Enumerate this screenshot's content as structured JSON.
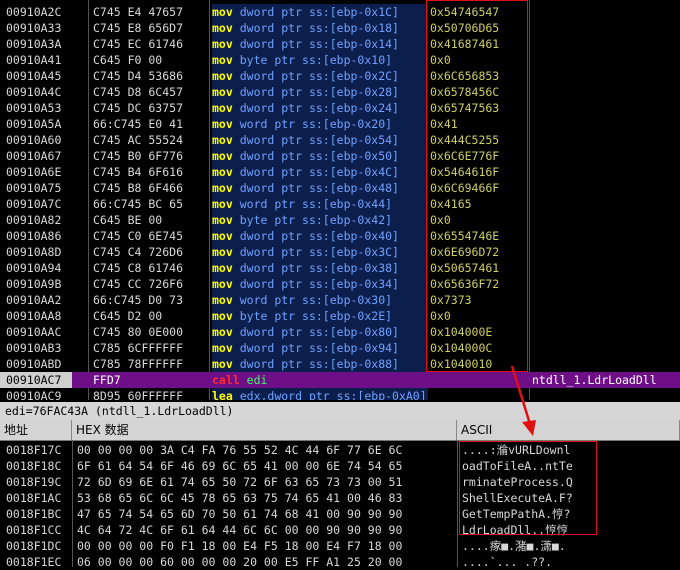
{
  "disasm": {
    "rows": [
      {
        "addr": "00910A2C",
        "hex": "C745 E4 47657",
        "mn": "mov",
        "ops": "dword ptr ss:[ebp-0x1C]",
        "val": "0x54746547",
        "comment": ""
      },
      {
        "addr": "00910A33",
        "hex": "C745 E8 656D7",
        "mn": "mov",
        "ops": "dword ptr ss:[ebp-0x18]",
        "val": "0x50706D65",
        "comment": ""
      },
      {
        "addr": "00910A3A",
        "hex": "C745 EC 61746",
        "mn": "mov",
        "ops": "dword ptr ss:[ebp-0x14]",
        "val": "0x41687461",
        "comment": ""
      },
      {
        "addr": "00910A41",
        "hex": "C645 F0 00",
        "mn": "mov",
        "ops": "byte ptr ss:[ebp-0x10]",
        "val": "0x0",
        "comment": ""
      },
      {
        "addr": "00910A45",
        "hex": "C745 D4 53686",
        "mn": "mov",
        "ops": "dword ptr ss:[ebp-0x2C]",
        "val": "0x6C656853",
        "comment": ""
      },
      {
        "addr": "00910A4C",
        "hex": "C745 D8 6C457",
        "mn": "mov",
        "ops": "dword ptr ss:[ebp-0x28]",
        "val": "0x6578456C",
        "comment": ""
      },
      {
        "addr": "00910A53",
        "hex": "C745 DC 63757",
        "mn": "mov",
        "ops": "dword ptr ss:[ebp-0x24]",
        "val": "0x65747563",
        "comment": ""
      },
      {
        "addr": "00910A5A",
        "hex": "66:C745 E0 41",
        "mn": "mov",
        "ops": "word ptr ss:[ebp-0x20]",
        "val": "0x41",
        "comment": ""
      },
      {
        "addr": "00910A60",
        "hex": "C745 AC 55524",
        "mn": "mov",
        "ops": "dword ptr ss:[ebp-0x54]",
        "val": "0x444C5255",
        "comment": ""
      },
      {
        "addr": "00910A67",
        "hex": "C745 B0 6F776",
        "mn": "mov",
        "ops": "dword ptr ss:[ebp-0x50]",
        "val": "0x6C6E776F",
        "comment": ""
      },
      {
        "addr": "00910A6E",
        "hex": "C745 B4 6F616",
        "mn": "mov",
        "ops": "dword ptr ss:[ebp-0x4C]",
        "val": "0x5464616F",
        "comment": ""
      },
      {
        "addr": "00910A75",
        "hex": "C745 B8 6F466",
        "mn": "mov",
        "ops": "dword ptr ss:[ebp-0x48]",
        "val": "0x6C69466F",
        "comment": ""
      },
      {
        "addr": "00910A7C",
        "hex": "66:C745 BC 65",
        "mn": "mov",
        "ops": "word ptr ss:[ebp-0x44]",
        "val": "0x4165",
        "comment": ""
      },
      {
        "addr": "00910A82",
        "hex": "C645 BE 00",
        "mn": "mov",
        "ops": "byte ptr ss:[ebp-0x42]",
        "val": "0x0",
        "comment": ""
      },
      {
        "addr": "00910A86",
        "hex": "C745 C0 6E745",
        "mn": "mov",
        "ops": "dword ptr ss:[ebp-0x40]",
        "val": "0x6554746E",
        "comment": ""
      },
      {
        "addr": "00910A8D",
        "hex": "C745 C4 726D6",
        "mn": "mov",
        "ops": "dword ptr ss:[ebp-0x3C]",
        "val": "0x6E696D72",
        "comment": ""
      },
      {
        "addr": "00910A94",
        "hex": "C745 C8 61746",
        "mn": "mov",
        "ops": "dword ptr ss:[ebp-0x38]",
        "val": "0x50657461",
        "comment": ""
      },
      {
        "addr": "00910A9B",
        "hex": "C745 CC 726F6",
        "mn": "mov",
        "ops": "dword ptr ss:[ebp-0x34]",
        "val": "0x65636F72",
        "comment": ""
      },
      {
        "addr": "00910AA2",
        "hex": "66:C745 D0 73",
        "mn": "mov",
        "ops": "word ptr ss:[ebp-0x30]",
        "val": "0x7373",
        "comment": ""
      },
      {
        "addr": "00910AA8",
        "hex": "C645 D2 00",
        "mn": "mov",
        "ops": "byte ptr ss:[ebp-0x2E]",
        "val": "0x0",
        "comment": ""
      },
      {
        "addr": "00910AAC",
        "hex": "C745 80 0E000",
        "mn": "mov",
        "ops": "dword ptr ss:[ebp-0x80]",
        "val": "0x104000E",
        "comment": ""
      },
      {
        "addr": "00910AB3",
        "hex": "C785 6CFFFFFF",
        "mn": "mov",
        "ops": "dword ptr ss:[ebp-0x94]",
        "val": "0x104000C",
        "comment": ""
      },
      {
        "addr": "00910ABD",
        "hex": "C785 78FFFFFF",
        "mn": "mov",
        "ops": "dword ptr ss:[ebp-0x88]",
        "val": "0x1040010",
        "comment": ""
      },
      {
        "addr": "00910AC7",
        "hex": "FFD7",
        "mn": "call",
        "ops": "edi",
        "val": "",
        "comment": "ntdll_1.LdrLoadDll",
        "selected": true
      },
      {
        "addr": "00910AC9",
        "hex": "8D95 60FFFFFF",
        "mn": "lea",
        "ops": "edx,dword ptr ss:[ebp-0xA0]",
        "val": "",
        "comment": ""
      }
    ]
  },
  "status_line": "edi=76FAC43A (ntdll_1.LdrLoadDll)",
  "dump": {
    "headers": {
      "addr": "地址",
      "hex": "HEX 数据",
      "ascii": "ASCII"
    },
    "rows": [
      {
        "addr": "0018F17C",
        "hex": "00 00 00 00 3A C4 FA 76 55 52 4C 44 6F 77 6E 6C",
        "ascii": "....:溣vURLDownl"
      },
      {
        "addr": "0018F18C",
        "hex": "6F 61 64 54 6F 46 69 6C 65 41 00 00 6E 74 54 65",
        "ascii": "oadToFileA..ntTe"
      },
      {
        "addr": "0018F19C",
        "hex": "72 6D 69 6E 61 74 65 50 72 6F 63 65 73 73 00 51",
        "ascii": "rminateProcess.Q"
      },
      {
        "addr": "0018F1AC",
        "hex": "53 68 65 6C 6C 45 78 65 63 75 74 65 41 00 46 83",
        "ascii": "ShellExecuteA.F?"
      },
      {
        "addr": "0018F1BC",
        "hex": "47 65 74 54 65 6D 70 50 61 74 68 41 00 90 90 90",
        "ascii": "GetTempPathA.悙?"
      },
      {
        "addr": "0018F1CC",
        "hex": "4C 64 72 4C 6F 61 64 44 6C 6C 00 00 90 90 90 90",
        "ascii": "LdrLoadDll..悙悙"
      },
      {
        "addr": "0018F1DC",
        "hex": "00 00 00 00 F0 F1 18 00 E4 F5 18 00 E4 F7 18 00",
        "ascii": "....瘃■.潴■.潇■."
      },
      {
        "addr": "0018F1EC",
        "hex": "06 00 00 00 60 00 00 00 20 00 E5 FF A1 25 20 00",
        "ascii": "....`... .??. "
      }
    ]
  },
  "colors": {
    "mnemonic": "#ffff00",
    "operand": "#6fa2ff",
    "selected_row": "#6e0f88",
    "highlight_box": "#e01010"
  }
}
